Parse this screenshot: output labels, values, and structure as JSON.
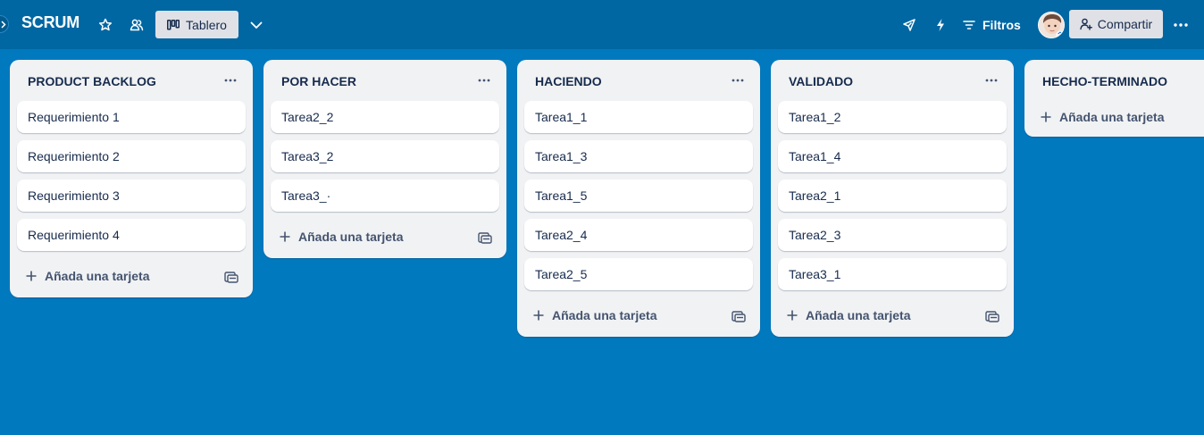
{
  "header": {
    "board_title": "SCRUM",
    "view_label": "Tablero",
    "filters_label": "Filtros",
    "share_label": "Compartir"
  },
  "lists": [
    {
      "title": "PRODUCT BACKLOG",
      "cards": [
        "Requerimiento 1",
        "Requerimiento 2",
        "Requerimiento 3",
        "Requerimiento 4"
      ],
      "add_label": "Añada una tarjeta"
    },
    {
      "title": "POR HACER",
      "cards": [
        "Tarea2_2",
        "Tarea3_2",
        "Tarea3_·"
      ],
      "add_label": "Añada una tarjeta"
    },
    {
      "title": "HACIENDO",
      "cards": [
        "Tarea1_1",
        "Tarea1_3",
        "Tarea1_5",
        "Tarea2_4",
        "Tarea2_5"
      ],
      "add_label": "Añada una tarjeta"
    },
    {
      "title": "VALIDADO",
      "cards": [
        "Tarea1_2",
        "Tarea1_4",
        "Tarea2_1",
        "Tarea2_3",
        "Tarea3_1"
      ],
      "add_label": "Añada una tarjeta"
    },
    {
      "title": "HECHO-TERMINADO",
      "cards": [],
      "add_label": "Añada una tarjeta"
    }
  ],
  "colors": {
    "board_bg": "#0079bf",
    "header_bg": "#0067a3",
    "list_bg": "#f1f2f4",
    "card_bg": "#ffffff",
    "text": "#172b4d"
  },
  "icons": {
    "collapse": "chevron-right-icon",
    "star": "star-icon",
    "visibility": "workspace-visibility-icon",
    "view": "board-view-icon",
    "view_switch": "chevron-down-icon",
    "power_ups": "rocket-icon",
    "automation": "lightning-icon",
    "filter": "filter-icon",
    "share": "add-person-icon",
    "more": "more-icon",
    "list_menu": "more-icon",
    "add": "plus-icon",
    "template": "card-template-icon"
  }
}
